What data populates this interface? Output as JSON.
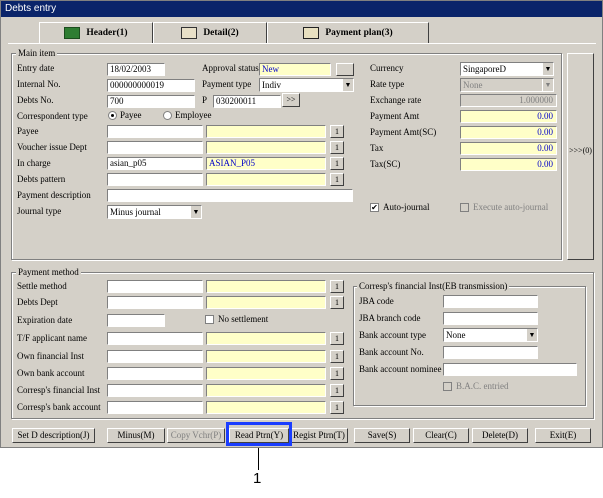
{
  "window": {
    "title": "Debts entry"
  },
  "tabs": [
    {
      "label": "Header(1)",
      "icon": "book-icon"
    },
    {
      "label": "Detail(2)",
      "icon": "notepad-icon"
    },
    {
      "label": "Payment plan(3)",
      "icon": "screen-icon"
    }
  ],
  "main": {
    "group_label": "Main item",
    "entry_date": {
      "label": "Entry date",
      "value": "18/02/2003"
    },
    "internal_no": {
      "label": "Internal No.",
      "value": "000000000019"
    },
    "debts_no": {
      "label": "Debts No.",
      "value": "700"
    },
    "approval_status": {
      "label": "Approval status",
      "value": "New"
    },
    "payment_type": {
      "label": "Payment type",
      "value": "Indiv"
    },
    "p": {
      "label": "P",
      "value": "030200011",
      "button": ">>"
    },
    "correspondent_type": {
      "label": "Correspondent type",
      "options": [
        "Payee",
        "Employee"
      ],
      "selected": "Payee"
    },
    "payee": {
      "label": "Payee",
      "code": "",
      "name": "",
      "button": "1"
    },
    "voucher_issue_dept": {
      "label": "Voucher issue Dept",
      "code": "",
      "name": "",
      "button": "1"
    },
    "in_charge": {
      "label": "In charge",
      "code": "asian_p05",
      "name": "ASIAN_P05",
      "button": "1"
    },
    "debts_pattern": {
      "label": "Debts pattern",
      "code": "",
      "name": "",
      "button": "1"
    },
    "payment_description": {
      "label": "Payment description",
      "value": ""
    },
    "journal_type": {
      "label": "Journal type",
      "value": "Minus journal"
    },
    "currency": {
      "label": "Currency",
      "value": "SingaporeD"
    },
    "rate_type": {
      "label": "Rate type",
      "value": "None"
    },
    "exchange_rate": {
      "label": "Exchange rate",
      "value": "1.000000"
    },
    "payment_amt": {
      "label": "Payment Amt",
      "value": "0.00"
    },
    "payment_amt_sc": {
      "label": "Payment Amt(SC)",
      "value": "0.00"
    },
    "tax": {
      "label": "Tax",
      "value": "0.00"
    },
    "tax_sc": {
      "label": "Tax(SC)",
      "value": "0.00"
    },
    "auto_journal": {
      "label": "Auto-journal",
      "checked": true,
      "mark": "✔"
    },
    "execute_auto_journal": {
      "label": "Execute auto-journal",
      "checked": false
    },
    "side_button": ">>>(0)"
  },
  "payment": {
    "group_label": "Payment method",
    "settle_method": {
      "label": "Settle method",
      "button": "1"
    },
    "debts_dept": {
      "label": "Debts Dept",
      "button": "1"
    },
    "expiration_date": {
      "label": "Expiration date",
      "value": ""
    },
    "no_settlement": {
      "label": "No settlement",
      "checked": false
    },
    "tf_applicant_name": {
      "label": "T/F applicant name",
      "button": "1"
    },
    "own_financial_inst": {
      "label": "Own financial Inst",
      "button": "1"
    },
    "own_bank_account": {
      "label": "Own bank account",
      "button": "1"
    },
    "corresp_financial_inst": {
      "label": "Corresp's financial Inst",
      "button": "1"
    },
    "corresp_bank_account": {
      "label": "Corresp's bank account",
      "button": "1"
    }
  },
  "eb": {
    "group_label": "Corresp's financial Inst(EB transmission)",
    "jba_code": {
      "label": "JBA code",
      "value": ""
    },
    "jba_branch_code": {
      "label": "JBA branch code",
      "value": ""
    },
    "bank_account_type": {
      "label": "Bank account type",
      "value": "None"
    },
    "bank_account_no": {
      "label": "Bank account No.",
      "value": ""
    },
    "bank_account_nominee": {
      "label": "Bank account nominee",
      "value": ""
    },
    "bac_entried": {
      "label": "B.A.C. entried",
      "checked": false
    }
  },
  "toolbar": {
    "set_d_description": "Set D description(J)",
    "minus": "Minus(M)",
    "copy_vchr": "Copy Vchr(P)",
    "read_ptrn": "Read Ptrn(Y)",
    "regist_ptrn": "Regist Ptrn(T)",
    "save": "Save(S)",
    "clear": "Clear(C)",
    "delete": "Delete(D)",
    "exit": "Exit(E)"
  },
  "callout": {
    "number": "1"
  },
  "colors": {
    "title_bar": "#0a246a",
    "highlight": "#1a3dff",
    "readonly_field": "#ffffc8",
    "face": "#d4d0c8"
  }
}
